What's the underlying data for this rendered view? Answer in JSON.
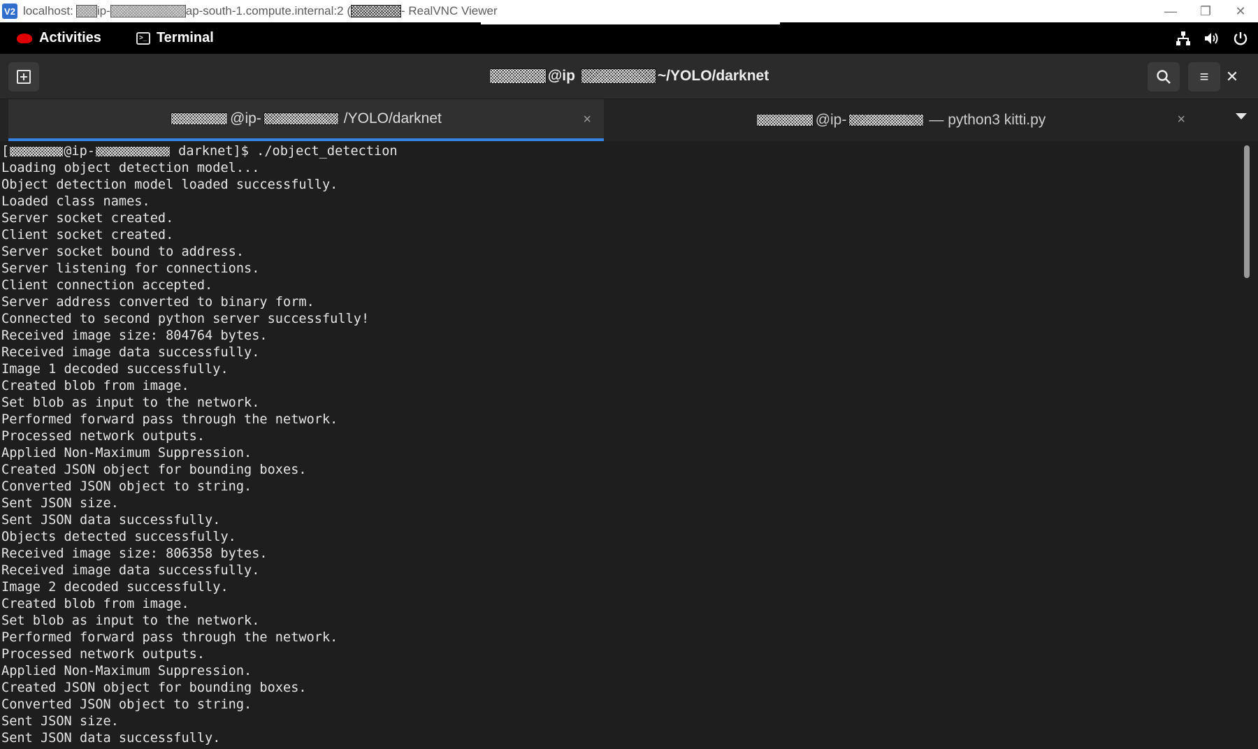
{
  "vnc_window": {
    "title_prefix": "localhost:",
    "title_ip": "ip-",
    "title_host": "ap-south-1.compute.internal:2 (",
    "title_suffix": " - RealVNC Viewer",
    "logo_text": "V2",
    "minimize": "—",
    "restore": "❐",
    "close": "✕"
  },
  "gnome_bar": {
    "activities": "Activities",
    "app_name": "Terminal",
    "icons": [
      "network-icon",
      "volume-icon",
      "power-icon"
    ]
  },
  "terminal_header": {
    "at_ip": "@ip",
    "path": "~/YOLO/darknet",
    "search_icon": "⌕",
    "menu_icon": "≡",
    "close_icon": "✕"
  },
  "tabs": [
    {
      "at_ip": "@ip-",
      "path": "/YOLO/darknet",
      "close": "×",
      "active": true
    },
    {
      "at_ip": "@ip-",
      "path": "— python3 kitti.py",
      "close": "×",
      "active": false
    }
  ],
  "terminal": {
    "prompt_open": "[",
    "prompt_at_ip": "@ip-",
    "prompt_rest": " darknet]$ ./object_detection",
    "lines": [
      "Loading object detection model...",
      "Object detection model loaded successfully.",
      "Loaded class names.",
      "Server socket created.",
      "Client socket created.",
      "Server socket bound to address.",
      "Server listening for connections.",
      "Client connection accepted.",
      "Server address converted to binary form.",
      "Connected to second python server successfully!",
      "Received image size: 804764 bytes.",
      "Received image data successfully.",
      "Image 1 decoded successfully.",
      "Created blob from image.",
      "Set blob as input to the network.",
      "Performed forward pass through the network.",
      "Processed network outputs.",
      "Applied Non-Maximum Suppression.",
      "Created JSON object for bounding boxes.",
      "Converted JSON object to string.",
      "Sent JSON size.",
      "Sent JSON data successfully.",
      "Objects detected successfully.",
      "Received image size: 806358 bytes.",
      "Received image data successfully.",
      "Image 2 decoded successfully.",
      "Created blob from image.",
      "Set blob as input to the network.",
      "Performed forward pass through the network.",
      "Processed network outputs.",
      "Applied Non-Maximum Suppression.",
      "Created JSON object for bounding boxes.",
      "Converted JSON object to string.",
      "Sent JSON size.",
      "Sent JSON data successfully."
    ]
  },
  "colors": {
    "accent": "#3584e4",
    "terminal_bg": "#1e1e1e",
    "terminal_fg": "#e6e6e6"
  }
}
